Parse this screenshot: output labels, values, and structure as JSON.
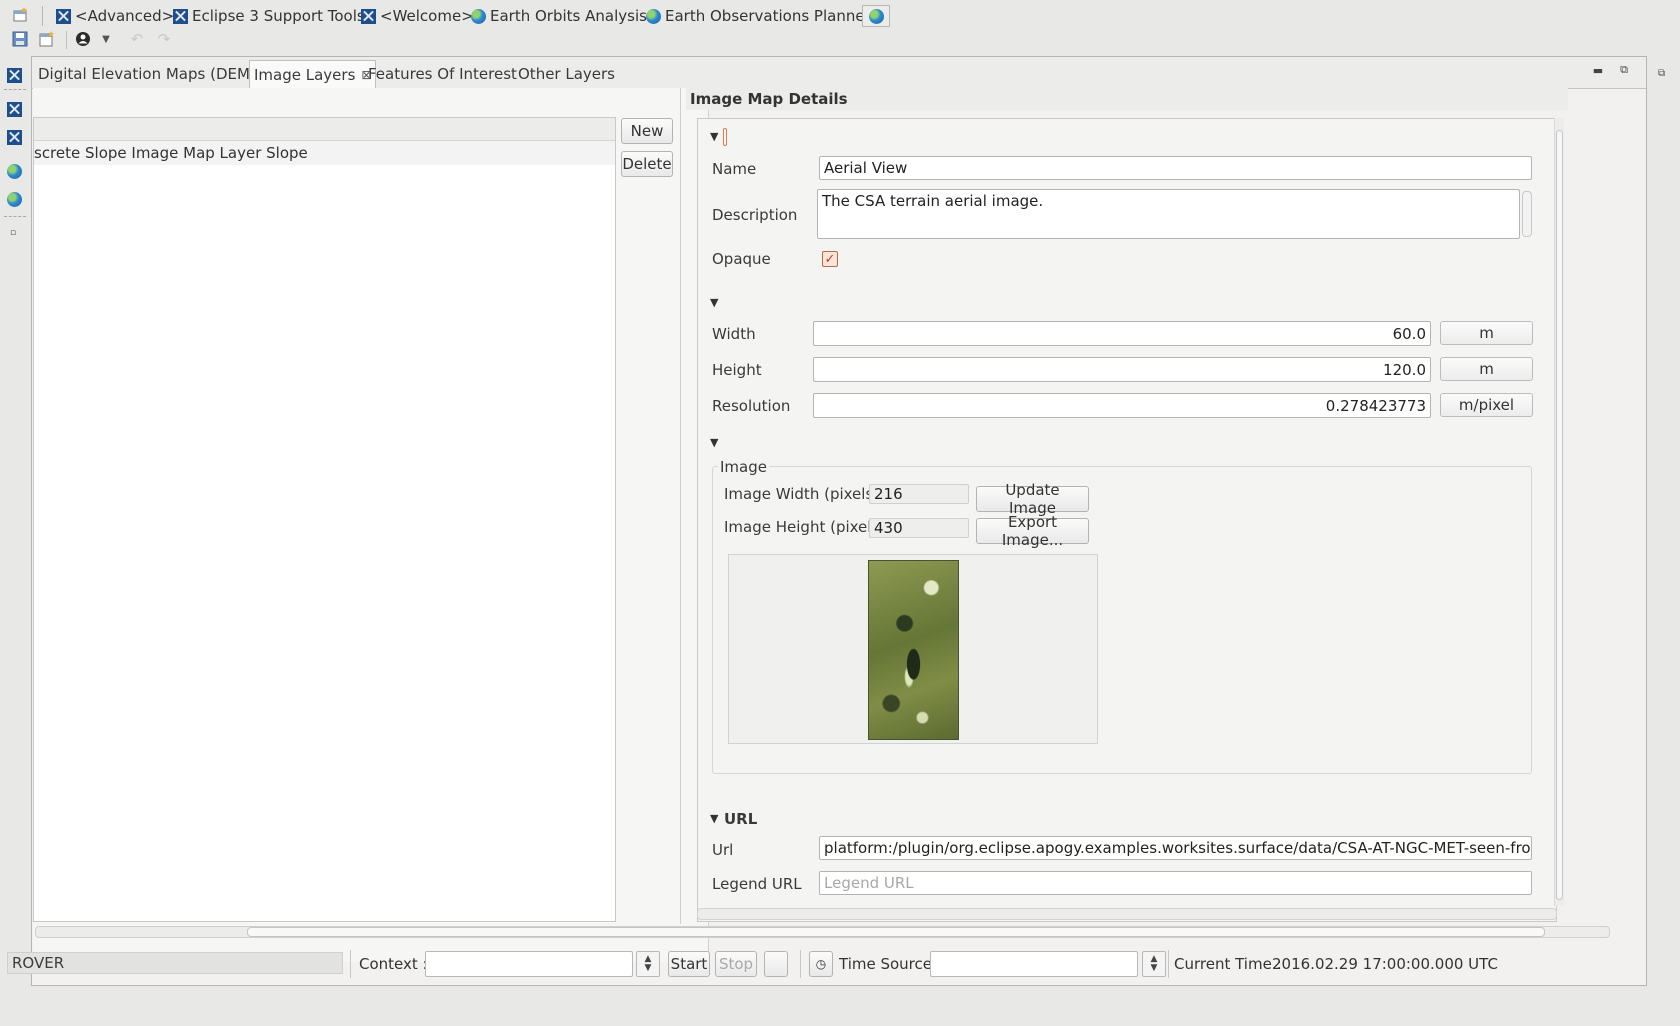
{
  "perspectives": [
    {
      "label": "<Advanced>",
      "icon": "eclipse-icon"
    },
    {
      "label": "Eclipse 3 Support Tools",
      "icon": "eclipse-icon"
    },
    {
      "label": "<Welcome>",
      "icon": "eclipse-icon"
    },
    {
      "label": "Earth Orbits Analysis",
      "icon": "globe-icon"
    },
    {
      "label": "Earth Observations Planner",
      "icon": "globe-icon"
    }
  ],
  "tabs": {
    "dems": "Digital Elevation Maps (DEMs)",
    "image_layers": "Image Layers",
    "features": "Features Of Interest",
    "other": "Other Layers"
  },
  "layer_list": {
    "rows": [
      "screte Slope Image Map Layer Slope"
    ],
    "new_label": "New",
    "delete_label": "Delete"
  },
  "details": {
    "title": "Image Map Details",
    "name_label": "Name",
    "name_value": "Aerial View",
    "description_label": "Description",
    "description_value": "The CSA terrain aerial image.",
    "opaque_label": "Opaque",
    "opaque_checked": true,
    "width_label": "Width",
    "width_value": "60.0",
    "width_unit": "m",
    "height_label": "Height",
    "height_value": "120.0",
    "height_unit": "m",
    "resolution_label": "Resolution",
    "resolution_value": "0.278423773",
    "resolution_unit": "m/pixel",
    "image_group_label": "Image",
    "image_width_label": "Image Width (pixels):",
    "image_width_value": "216",
    "image_height_label": "Image Height (pixels):",
    "image_height_value": "430",
    "update_image_label": "Update Image",
    "export_image_label": "Export Image...",
    "url_section_label": "URL",
    "url_label": "Url",
    "url_value": "platform:/plugin/org.eclipse.apogy.examples.worksites.surface/data/CSA-AT-NGC-MET-seen-from-sky.jpg",
    "legend_url_label": "Legend URL",
    "legend_url_placeholder": "Legend URL"
  },
  "status_bar": {
    "rover_label": "ROVER",
    "context_label": "Context :",
    "start_label": "Start",
    "stop_label": "Stop",
    "time_source_label": "Time Source :",
    "current_time_label": "Current Time :",
    "current_time_value": "2016.02.29 17:00:00.000 UTC"
  },
  "colors": {
    "accent_checkbox": "#c0392b",
    "eclipse_icon": "#1f4e8c"
  }
}
